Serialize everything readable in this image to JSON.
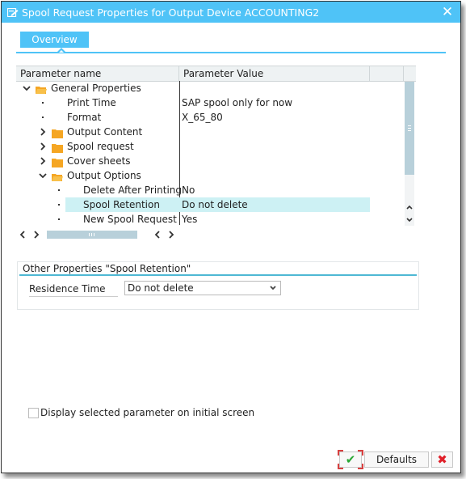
{
  "window": {
    "title": "Spool Request Properties for Output Device ACCOUNTING2",
    "title_icon": "edit-window-icon",
    "close_glyph": "✕"
  },
  "tabs": [
    {
      "label": "Overview",
      "active": true
    }
  ],
  "tree": {
    "columns": [
      "Parameter name",
      "Parameter Value"
    ],
    "rows": [
      {
        "name": "General Properties",
        "value": "",
        "type": "folder",
        "expanded": true,
        "level": 0
      },
      {
        "name": "Print Time",
        "value": "SAP spool only for now",
        "type": "leaf",
        "level": 1
      },
      {
        "name": "Format",
        "value": "X_65_80",
        "type": "leaf",
        "level": 1
      },
      {
        "name": "Output Content",
        "value": "",
        "type": "folder",
        "expanded": false,
        "level": 1
      },
      {
        "name": "Spool request",
        "value": "",
        "type": "folder",
        "expanded": false,
        "level": 1
      },
      {
        "name": "Cover sheets",
        "value": "",
        "type": "folder",
        "expanded": false,
        "level": 1
      },
      {
        "name": "Output Options",
        "value": "",
        "type": "folder",
        "expanded": true,
        "level": 1
      },
      {
        "name": "Delete After Printing",
        "value": "No",
        "type": "leaf",
        "level": 2
      },
      {
        "name": "Spool Retention",
        "value": "Do not delete",
        "type": "leaf",
        "level": 2,
        "selected": true
      },
      {
        "name": "New Spool Request",
        "value": "Yes",
        "type": "leaf",
        "level": 2
      }
    ]
  },
  "other_properties": {
    "title": "Other Properties \"Spool Retention\"",
    "field_label": "Residence Time",
    "field_value": "Do not delete"
  },
  "checkbox": {
    "label": "Display selected parameter on initial screen",
    "checked": false
  },
  "buttons": {
    "ok_glyph": "✔",
    "defaults_label": "Defaults",
    "cancel_glyph": "✖"
  },
  "colors": {
    "accent": "#4fc3f7",
    "selection": "#cdf1f4",
    "folder": "#f5a623",
    "ok": "#2aa836",
    "cancel": "#e0202a"
  }
}
